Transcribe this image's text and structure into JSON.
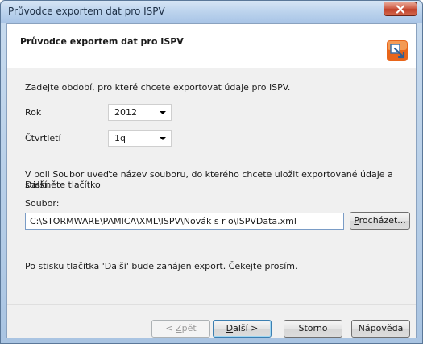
{
  "window": {
    "title": "Průvodce exportem dat pro ISPV"
  },
  "header": {
    "title": "Průvodce exportem dat pro ISPV"
  },
  "intro": {
    "text": "Zadejte období, pro které chcete exportovat údaje pro ISPV."
  },
  "fields": {
    "rok_label": "Rok",
    "rok_value": "2012",
    "ctvrtleti_label": "Čtvrtletí",
    "ctvrtleti_value": "1q"
  },
  "file": {
    "instruction_line1": "V poli Soubor uveďte název souboru, do kterého chcete uložit exportované údaje a stiskněte tlačítko",
    "instruction_line2": "Další.",
    "label": "Soubor:",
    "value": "C:\\STORMWARE\\PAMICA\\XML\\ISPV\\Novák s r o\\ISPVData.xml",
    "browse_pre": "",
    "browse_u": "P",
    "browse_post": "rocházet..."
  },
  "status": {
    "text": "Po stisku tlačítka 'Další' bude zahájen export. Čekejte prosím."
  },
  "buttons": {
    "back_pre": "< ",
    "back_u": "Z",
    "back_post": "pět",
    "next_u": "D",
    "next_post": "alší >",
    "cancel": "Storno",
    "help": "Nápověda"
  },
  "colors": {
    "accent": "#e8651a",
    "title_bar": "#b9d1ec",
    "close": "#c0412a"
  }
}
